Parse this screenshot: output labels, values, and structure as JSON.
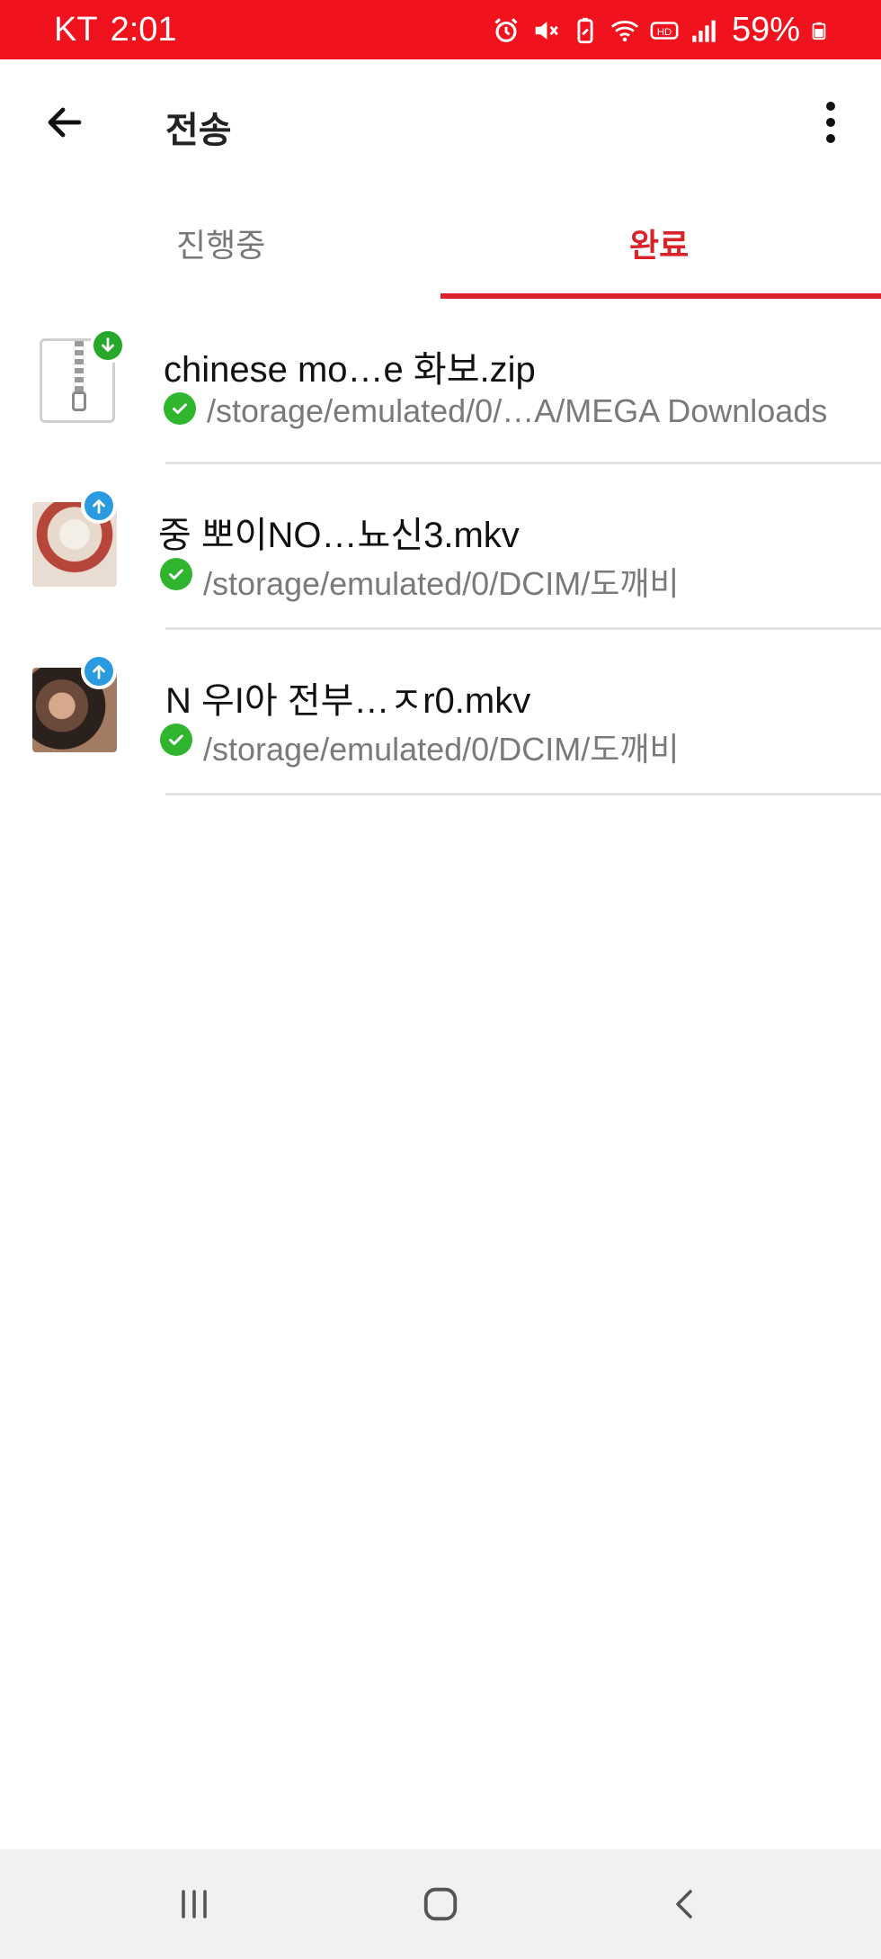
{
  "status_bar": {
    "carrier": "KT",
    "time": "2:01",
    "battery": "59%",
    "icons": [
      "alarm-icon",
      "mute-icon",
      "battery-saver-icon",
      "wifi-icon",
      "hd-voice-icon",
      "signal-icon",
      "battery-icon"
    ],
    "background": "#f0121c"
  },
  "app_bar": {
    "title": "전송",
    "back_icon": "arrow-left-icon",
    "menu_icon": "more-vertical-icon"
  },
  "tabs": {
    "items": [
      {
        "label": "진행중",
        "selected": false
      },
      {
        "label": "완료",
        "selected": true
      }
    ],
    "accent": "#d8232a"
  },
  "transfers": [
    {
      "name": "chinese mo…e 화보.zip",
      "path": "/storage/emulated/0/…A/MEGA Downloads",
      "direction": "download",
      "thumbnail": "zip-file-icon",
      "status": "completed"
    },
    {
      "name": "중 뽀이NO…뇨신3.mkv",
      "path": "/storage/emulated/0/DCIM/도깨비",
      "direction": "upload",
      "thumbnail": "video-thumbnail",
      "status": "completed"
    },
    {
      "name": "N 우I아 전부…ㅈr0.mkv",
      "path": "/storage/emulated/0/DCIM/도깨비",
      "direction": "upload",
      "thumbnail": "video-thumbnail",
      "status": "completed"
    }
  ],
  "nav_bar": {
    "buttons": [
      "recent-apps-icon",
      "home-icon",
      "back-icon"
    ]
  }
}
